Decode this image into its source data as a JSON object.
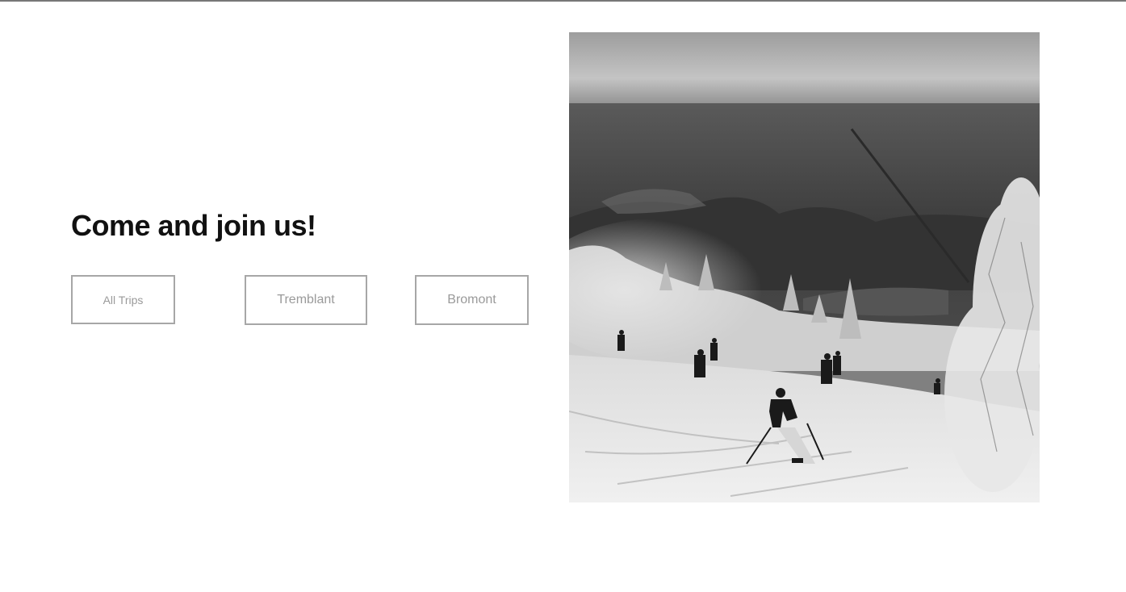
{
  "section": {
    "heading": "Come and join us!"
  },
  "filters": [
    {
      "label": "All Trips"
    },
    {
      "label": "Tremblant"
    },
    {
      "label": "Bromont"
    }
  ],
  "image": {
    "subject": "black-and-white photo of skiers descending a snowy slope with forest and valley view"
  },
  "colors": {
    "heading": "#111111",
    "button_border": "#a7a7a7",
    "button_text": "#9a9a9a",
    "top_rule": "#777777"
  }
}
